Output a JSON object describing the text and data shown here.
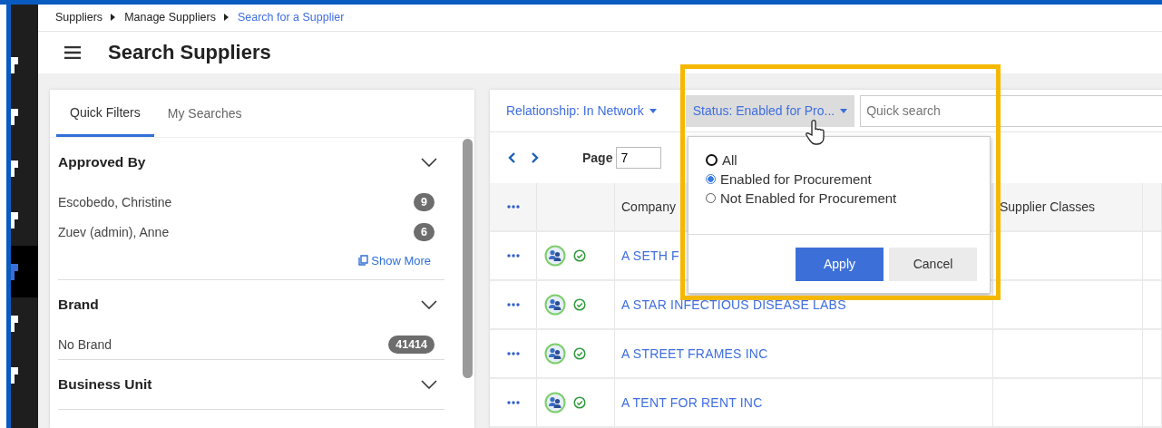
{
  "rail": [
    {
      "selected": false
    },
    {
      "selected": false
    },
    {
      "selected": false
    },
    {
      "selected": false
    },
    {
      "selected": true
    },
    {
      "selected": false
    },
    {
      "selected": false
    }
  ],
  "breadcrumb": [
    {
      "label": "Suppliers",
      "current": false
    },
    {
      "label": "Manage Suppliers",
      "current": false
    },
    {
      "label": "Search for a Supplier",
      "current": true
    }
  ],
  "title": "Search Suppliers",
  "filter_tabs": [
    {
      "label": "Quick Filters",
      "selected": true
    },
    {
      "label": "My Searches",
      "selected": false
    }
  ],
  "filter_sections": [
    {
      "title": "Approved By",
      "items": [
        {
          "label": "Escobedo, Christine",
          "count": "9"
        },
        {
          "label": "Zuev (admin), Anne",
          "count": "6"
        }
      ],
      "show_more": "Show More"
    },
    {
      "title": "Brand",
      "items": [
        {
          "label": "No Brand",
          "count": "41414"
        }
      ]
    },
    {
      "title": "Business Unit"
    }
  ],
  "toolbar": {
    "relationship": "Relationship: In Network",
    "status": "Status: Enabled for Pro...",
    "search_placeholder": "Quick search"
  },
  "pager": {
    "label": "Page",
    "value": "7"
  },
  "table": {
    "columns": [
      "Company",
      "Supplier Classes"
    ],
    "rows": [
      {
        "company": "A SETH F"
      },
      {
        "company": "A STAR INFECTIOUS DISEASE LABS"
      },
      {
        "company": "A STREET FRAMES INC"
      },
      {
        "company": "A TENT FOR RENT INC"
      }
    ]
  },
  "status_menu": {
    "options": [
      {
        "label": "All",
        "selected": false
      },
      {
        "label": "Enabled for Procurement",
        "selected": true
      },
      {
        "label": "Not Enabled for Procurement",
        "selected": false
      }
    ],
    "apply": "Apply",
    "cancel": "Cancel"
  }
}
